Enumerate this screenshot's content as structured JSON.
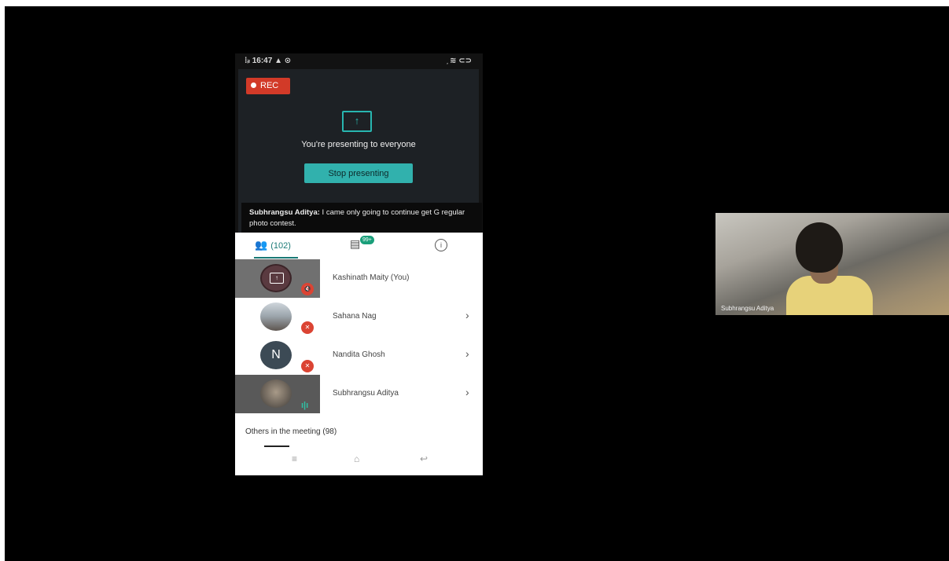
{
  "phone": {
    "status_time": "16:47",
    "status_left_glyphs": "⁞ᵢₗ 16:47 ▲ ⊙",
    "status_right_glyphs": "᷊ ≋ ⊂⊃"
  },
  "presenting": {
    "rec_label": "REC",
    "message": "You're presenting to everyone",
    "stop_button": "Stop presenting"
  },
  "caption": {
    "speaker": "Subhrangsu Aditya:",
    "text": " I came only going to continue get G regular photo contest."
  },
  "tabs": {
    "people_count": "(102)",
    "chat_badge": "99+",
    "info_glyph": "i"
  },
  "participants": [
    {
      "name": "Kashinath Maity (You)",
      "initial": "",
      "status": "muted-presenting"
    },
    {
      "name": "Sahana Nag",
      "initial": "",
      "status": "muted"
    },
    {
      "name": "Nandita Ghosh",
      "initial": "N",
      "status": "muted"
    },
    {
      "name": "Subhrangsu Aditya",
      "initial": "",
      "status": "speaking"
    }
  ],
  "others_label": "Others in the meeting (98)",
  "video_tile": {
    "name": "Subhrangsu Aditya"
  },
  "colors": {
    "accent_teal": "#31b1ad",
    "rec_red": "#d23a28",
    "mute_red": "#db4433"
  },
  "icons": [
    "present-screen-icon",
    "people-icon",
    "chat-icon",
    "info-icon",
    "mic-off-icon",
    "chevron-right-icon",
    "speaking-icon",
    "nav-menu-icon",
    "nav-home-icon",
    "nav-back-icon"
  ]
}
